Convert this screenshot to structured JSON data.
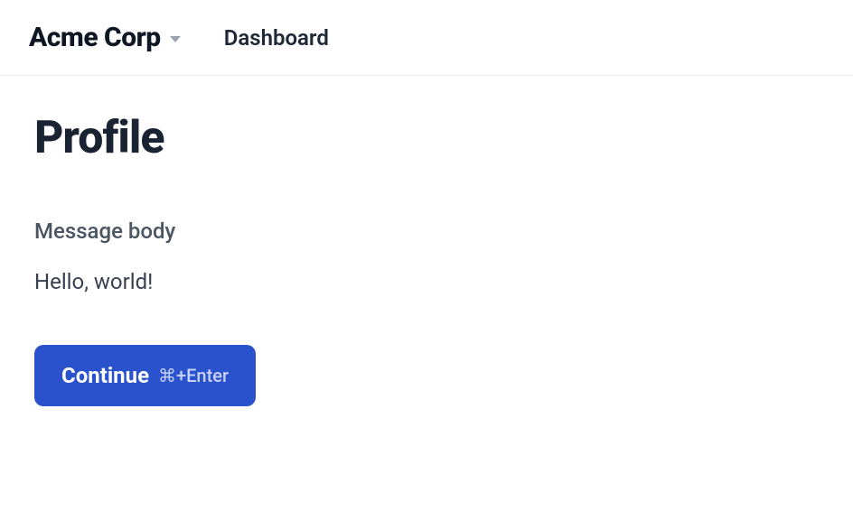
{
  "header": {
    "org_name": "Acme Corp",
    "nav": {
      "dashboard": "Dashboard"
    }
  },
  "main": {
    "title": "Profile",
    "field_label": "Message body",
    "field_value": "Hello, world!",
    "button": {
      "label": "Continue",
      "shortcut": "⌘+Enter"
    }
  }
}
